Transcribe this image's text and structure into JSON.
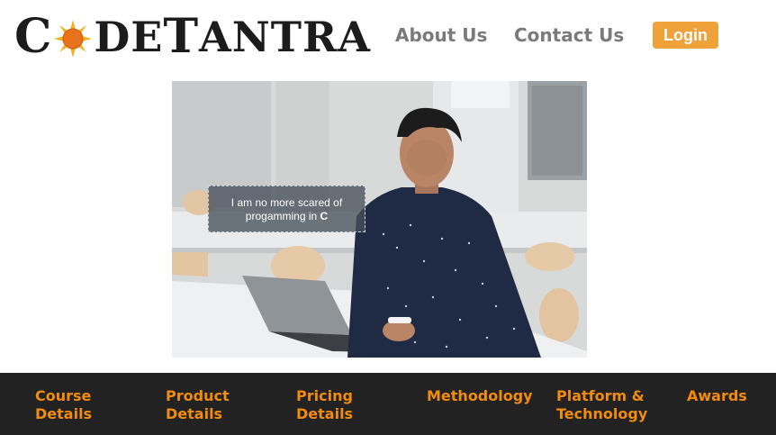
{
  "brand": {
    "logo_left": "C",
    "logo_mid": "DE",
    "logo_t": "T",
    "logo_right": "ANTRA"
  },
  "nav": {
    "about": "About Us",
    "contact": "Contact Us",
    "login": "Login"
  },
  "hero": {
    "caption_line1": "I am no more scared of",
    "caption_line2": "progamming in ",
    "caption_bold": "C"
  },
  "footer": {
    "items": [
      {
        "line1": "Course",
        "line2": "Details"
      },
      {
        "line1": "Product",
        "line2": "Details"
      },
      {
        "line1": "Pricing",
        "line2": "Details"
      },
      {
        "line1": "Methodology",
        "line2": ""
      },
      {
        "line1": "Platform &",
        "line2": "Technology"
      },
      {
        "line1": "Awards",
        "line2": ""
      }
    ]
  },
  "colors": {
    "accent": "#f0a23a",
    "footer_bg": "#222222",
    "footer_text": "#f28c10",
    "nav_text": "#7a7a7a"
  }
}
